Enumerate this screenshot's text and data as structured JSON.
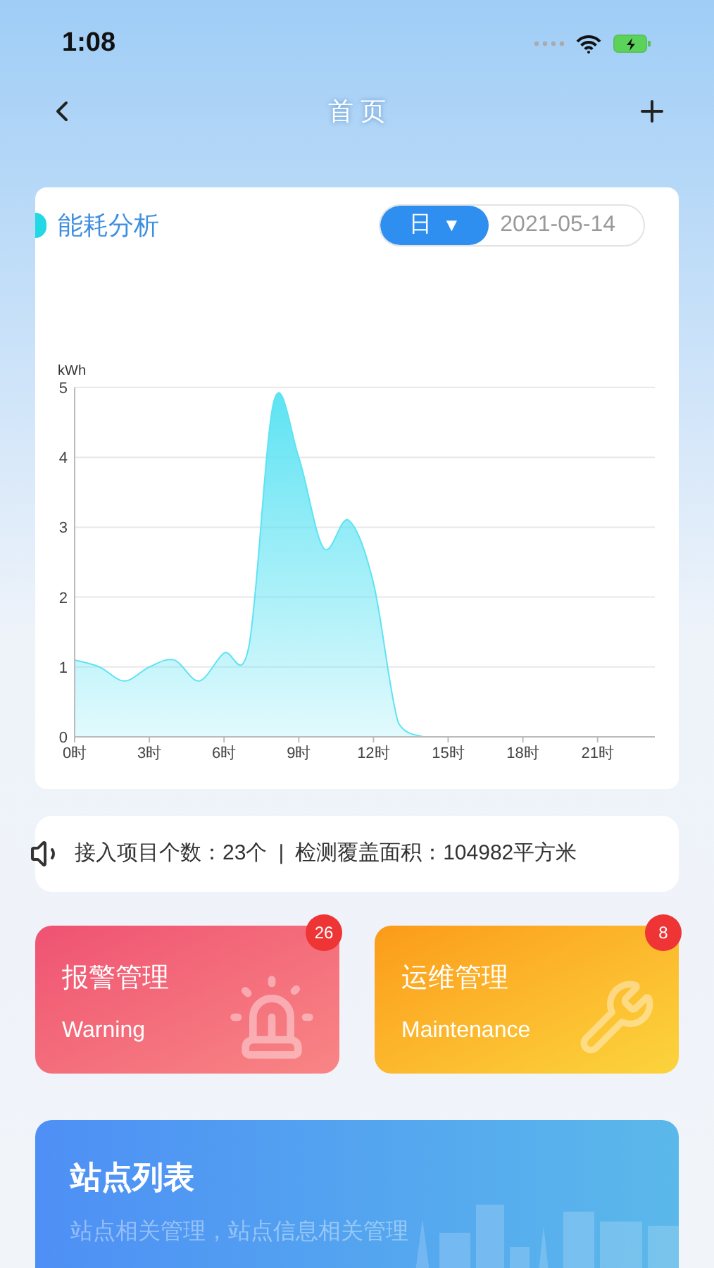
{
  "status_bar": {
    "time": "1:08"
  },
  "nav": {
    "title": "首 页"
  },
  "energy": {
    "title": "能耗分析",
    "period": {
      "label": "日",
      "caret": "▼"
    },
    "date": "2021-05-14",
    "chart_data": {
      "type": "area",
      "ylabel": "kWh",
      "grid": true,
      "x": [
        0,
        1,
        2,
        3,
        4,
        5,
        6,
        7,
        8,
        9,
        10,
        11,
        12,
        13,
        14
      ],
      "series": [
        {
          "color": "#5ee3f3",
          "values": [
            1.1,
            1.0,
            0.8,
            1.0,
            1.1,
            0.8,
            1.2,
            1.3,
            4.8,
            4.0,
            2.7,
            3.1,
            2.2,
            0.2,
            0
          ]
        }
      ],
      "xlim": [
        0,
        23.3
      ],
      "ylim": [
        0,
        5
      ],
      "yticks": [
        0,
        1,
        2,
        3,
        4,
        5
      ],
      "xticks": [
        {
          "value": 0,
          "label": "0时"
        },
        {
          "value": 3,
          "label": "3时"
        },
        {
          "value": 6,
          "label": "6时"
        },
        {
          "value": 9,
          "label": "9时"
        },
        {
          "value": 12,
          "label": "12时"
        },
        {
          "value": 15,
          "label": "15时"
        },
        {
          "value": 18,
          "label": "18时"
        },
        {
          "value": 21,
          "label": "21时"
        }
      ]
    }
  },
  "info": {
    "projects": "接入项目个数：23个",
    "separator": "|",
    "area": "检测覆盖面积：104982平方米"
  },
  "modules": [
    {
      "kind": "warning",
      "title": "报警管理",
      "subtitle": "Warning",
      "badge": "26"
    },
    {
      "kind": "maintenance",
      "title": "运维管理",
      "subtitle": "Maintenance",
      "badge": "8"
    }
  ],
  "station": {
    "title": "站点列表",
    "subtitle": "站点相关管理，站点信息相关管理"
  }
}
